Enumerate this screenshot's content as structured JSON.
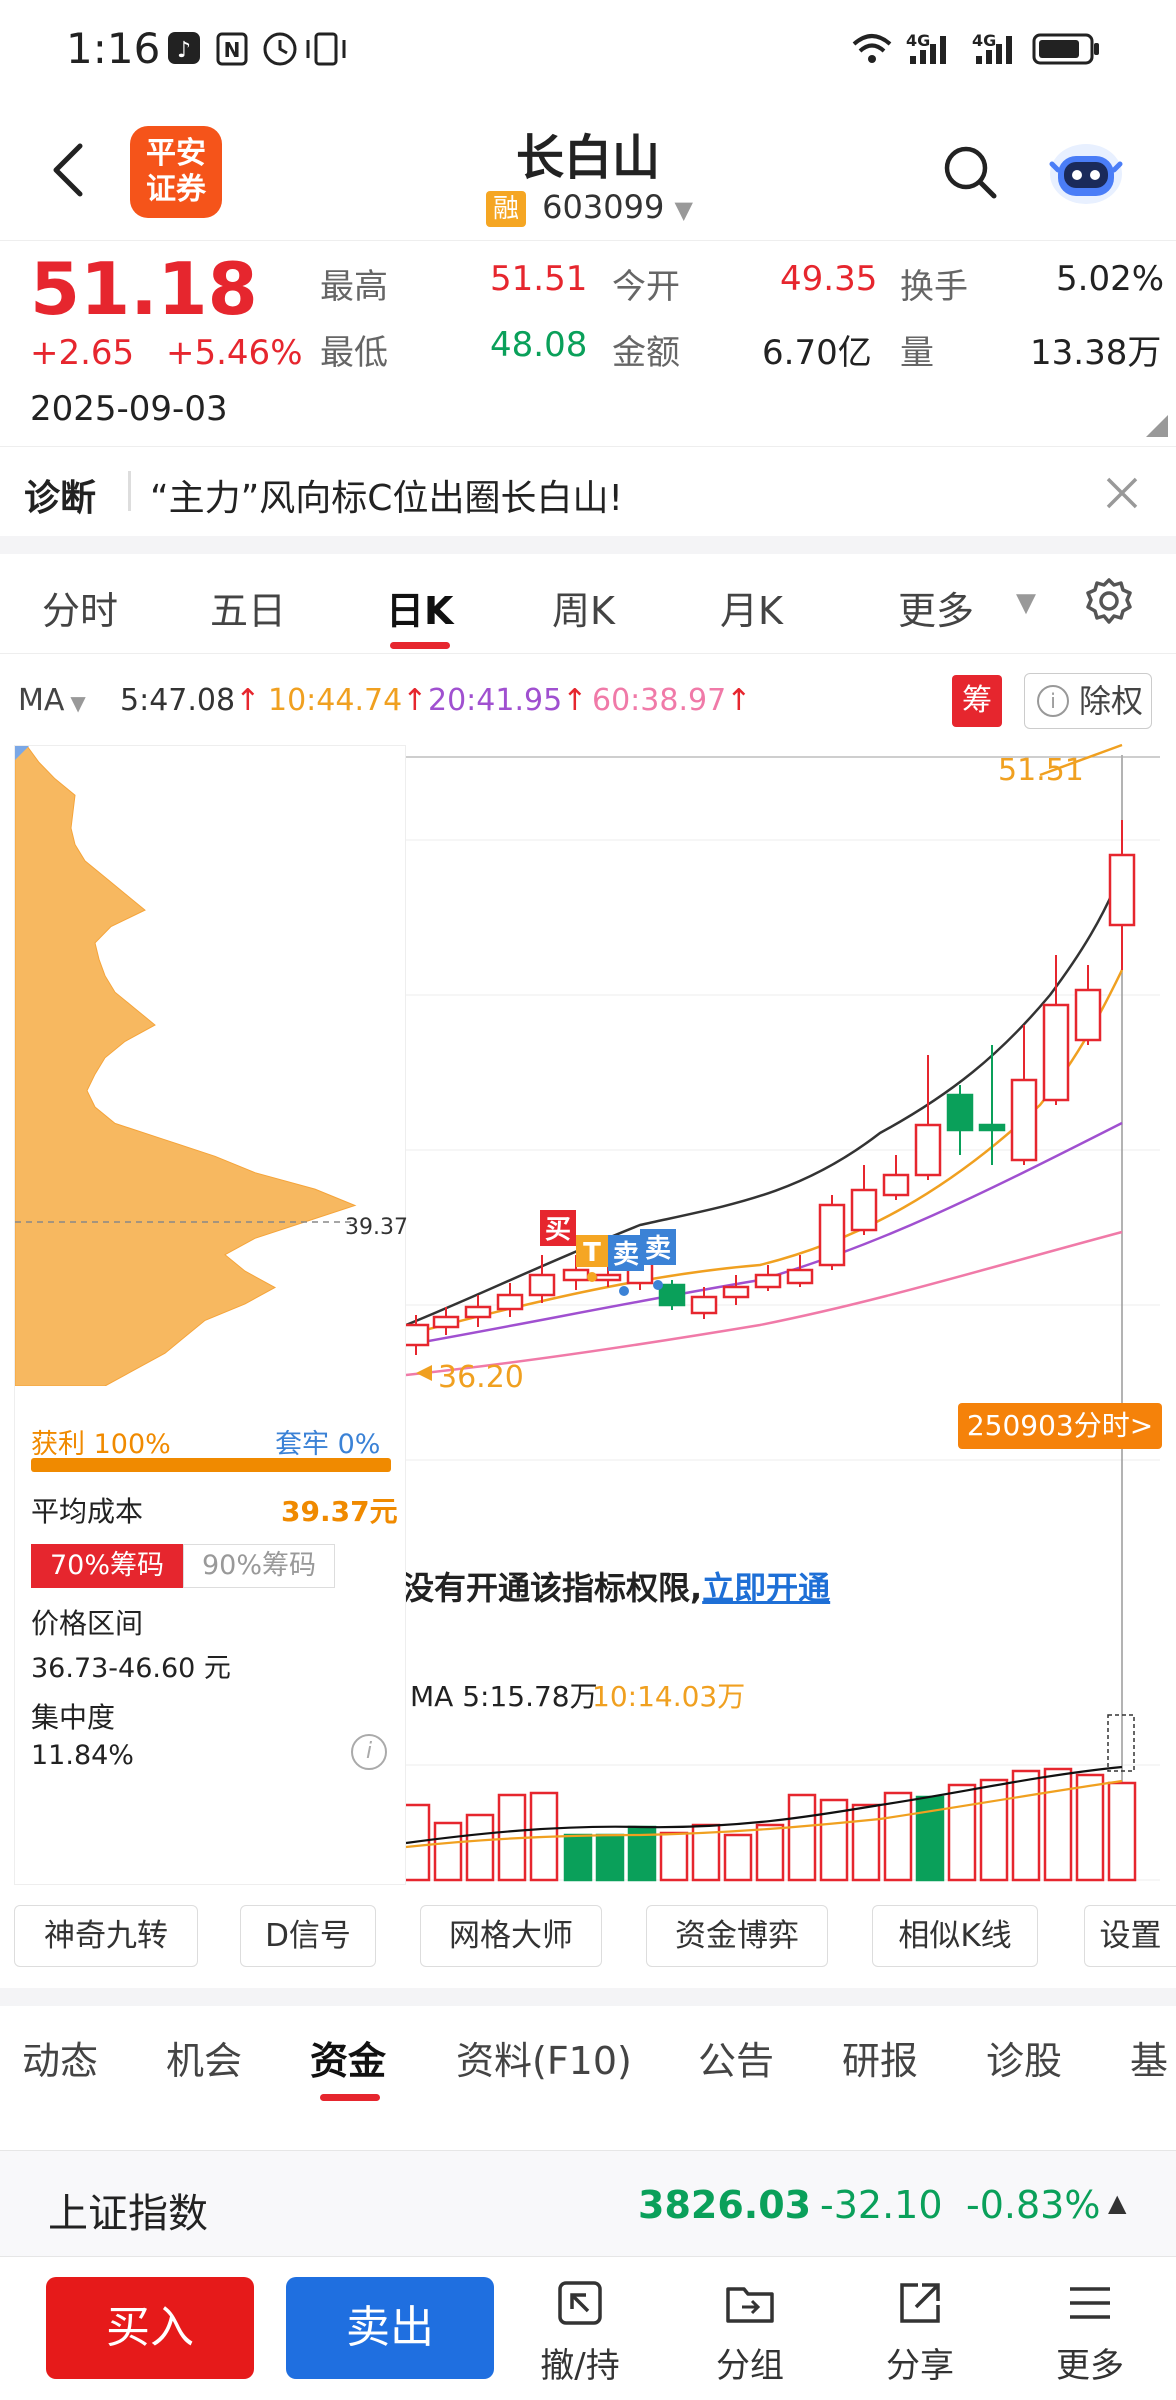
{
  "status_bar": {
    "time": "1:16",
    "network1": "4G",
    "network2": "4G"
  },
  "nav": {
    "title": "长白山",
    "code": "603099",
    "margin_badge": "融",
    "logo_text_1": "平安",
    "logo_text_2": "证券"
  },
  "quote": {
    "price": "51.18",
    "change": "+2.65",
    "change_pct": "+5.46%",
    "date": "2025-09-03",
    "high_label": "最高",
    "high": "51.51",
    "low_label": "最低",
    "low": "48.08",
    "open_label": "今开",
    "open": "49.35",
    "amount_label": "金额",
    "amount": "6.70亿",
    "turnover_label": "换手",
    "turnover": "5.02%",
    "volume_label": "量",
    "volume": "13.38万"
  },
  "diagnose": {
    "label": "诊断",
    "text": "“主力”风向标C位出圈长白山!"
  },
  "period_tabs": [
    {
      "label": "分时",
      "active": false
    },
    {
      "label": "五日",
      "active": false
    },
    {
      "label": "日K",
      "active": true
    },
    {
      "label": "周K",
      "active": false
    },
    {
      "label": "月K",
      "active": false
    },
    {
      "label": "更多",
      "active": false
    }
  ],
  "ma_bar": {
    "label": "MA",
    "ma5": "5:47.08",
    "ma10": "10:44.74",
    "ma20": "20:41.95",
    "ma60": "60:38.97",
    "chou_badge": "筹",
    "fq_label": "除权",
    "colors": {
      "ma5": "#333333",
      "ma10": "#f0a020",
      "ma20": "#a050d0",
      "ma60": "#f07aa8"
    }
  },
  "chart": {
    "high_label": "51.51",
    "low_label": "36.20",
    "chip_cost_label": "39.37",
    "signals": [
      "买",
      "T",
      "卖",
      "卖"
    ],
    "fenshi_button": "250903分时>",
    "permission_text": "没有开通该指标权限,",
    "permission_link": "立即开通",
    "vol_ma_label": "MA 5:15.78万",
    "vol_ma10_label": "10:14.03万"
  },
  "chips": {
    "profit_label": "获利 100%",
    "trapped_label": "套牢 0%",
    "avg_cost_label": "平均成本",
    "avg_cost": "39.37元",
    "tab70": "70%筹码",
    "tab90": "90%筹码",
    "range_label": "价格区间",
    "range": "36.73-46.60 元",
    "conc_label": "集中度",
    "conc": "11.84%"
  },
  "tools": [
    "神奇九转",
    "D信号",
    "网格大师",
    "资金博弈",
    "相似K线",
    "设置"
  ],
  "content_tabs": [
    {
      "label": "动态",
      "active": false
    },
    {
      "label": "机会",
      "active": false
    },
    {
      "label": "资金",
      "active": true
    },
    {
      "label": "资料(F10)",
      "active": false
    },
    {
      "label": "公告",
      "active": false
    },
    {
      "label": "研报",
      "active": false
    },
    {
      "label": "诊股",
      "active": false
    },
    {
      "label": "基",
      "active": false
    }
  ],
  "index_bar": {
    "name": "上证指数",
    "value": "3826.03",
    "change": "-32.10",
    "pct": "-0.83%"
  },
  "bottom": {
    "buy": "买入",
    "sell": "卖出",
    "withdraw": "撤/持",
    "group": "分组",
    "share": "分享",
    "more": "更多"
  }
}
